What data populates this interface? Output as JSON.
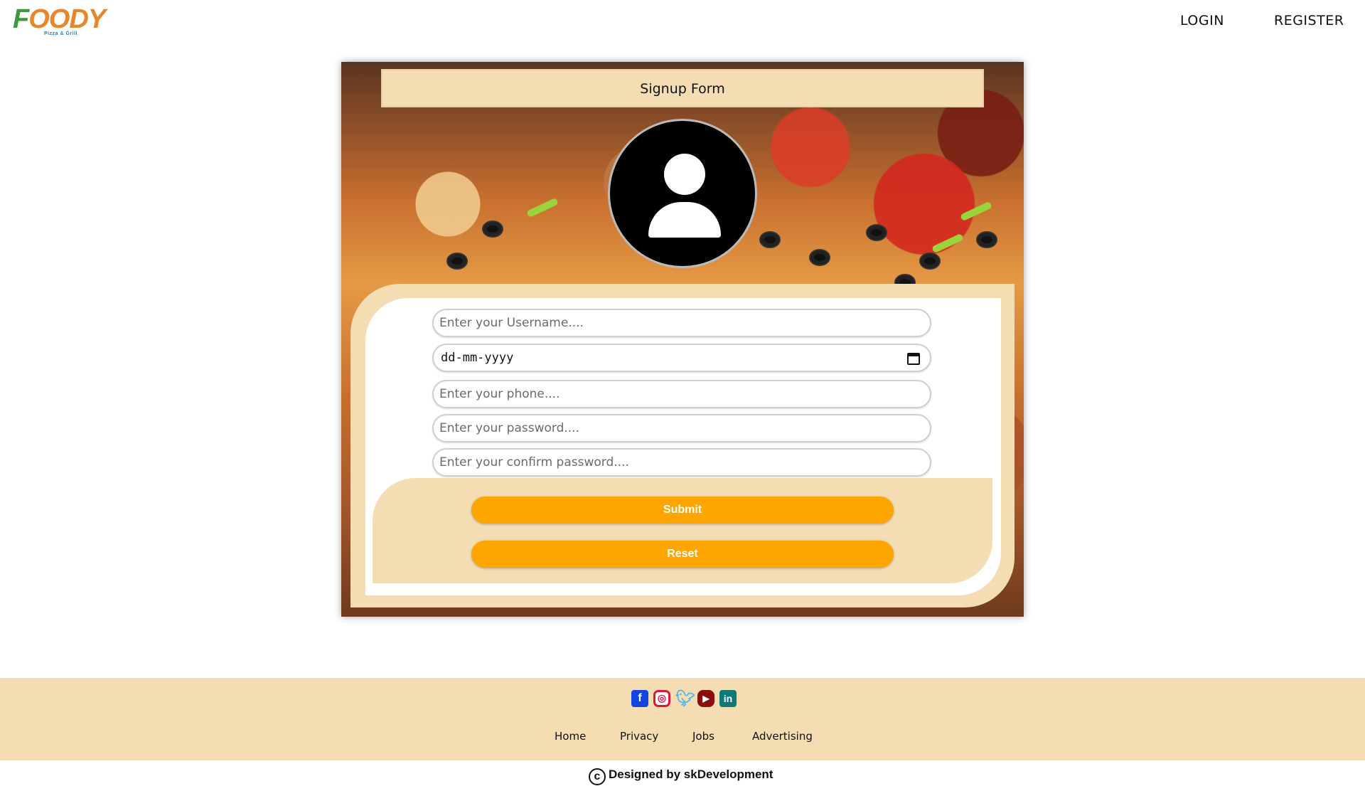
{
  "header": {
    "logo_text": "FOODY",
    "logo_subtext": "Pizza & Grill",
    "nav": {
      "login": "LOGIN",
      "register": "REGISTER"
    }
  },
  "signup": {
    "title": "Signup Form",
    "fields": {
      "username_placeholder": "Enter your Username....",
      "date_placeholder": "dd-mm-yyyy",
      "phone_placeholder": "Enter your phone....",
      "password_placeholder": "Enter your password....",
      "confirm_placeholder": "Enter your confirm password...."
    },
    "buttons": {
      "submit": "Submit",
      "reset": "Reset"
    }
  },
  "footer": {
    "socials": [
      "facebook-icon",
      "instagram-icon",
      "twitter-icon",
      "youtube-icon",
      "linkedin-icon"
    ],
    "links": {
      "home": "Home",
      "privacy": "Privacy",
      "jobs": "Jobs",
      "advertising": "Advertising"
    },
    "credit": "Designed by skDevelopment"
  },
  "colors": {
    "accent": "#ffa500",
    "panel": "#f5ddb3",
    "card_bg": "#ffffff"
  }
}
